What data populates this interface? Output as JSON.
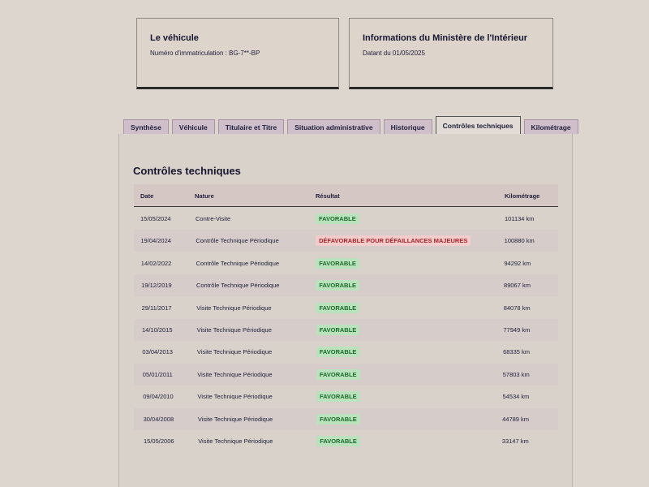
{
  "vehicle_card": {
    "title": "Le véhicule",
    "plate": "Numéro d'immatriculation : BG-7**-BP"
  },
  "ministry_card": {
    "title": "Informations du Ministère de l'Intérieur",
    "date": "Datant du 01/05/2025"
  },
  "tabs": [
    {
      "label": "Synthèse",
      "active": false
    },
    {
      "label": "Véhicule",
      "active": false
    },
    {
      "label": "Titulaire et Titre",
      "active": false
    },
    {
      "label": "Situation administrative",
      "active": false
    },
    {
      "label": "Historique",
      "active": false
    },
    {
      "label": "Contrôles techniques",
      "active": true
    },
    {
      "label": "Kilométrage",
      "active": false
    }
  ],
  "section": {
    "title": "Contrôles techniques",
    "columns": {
      "date": "Date",
      "nature": "Nature",
      "result": "Résultat",
      "mileage": "Kilométrage"
    }
  },
  "rows": [
    {
      "date": "15/05/2024",
      "nature": "Contre-Visite",
      "result": "FAVORABLE",
      "status": "ok",
      "mileage": "101134 km"
    },
    {
      "date": "19/04/2024",
      "nature": "Contrôle Technique Périodique",
      "result": "DÉFAVORABLE POUR DÉFAILLANCES MAJEURES",
      "status": "ko",
      "mileage": "100880 km"
    },
    {
      "date": "14/02/2022",
      "nature": "Contrôle Technique Périodique",
      "result": "FAVORABLE",
      "status": "ok",
      "mileage": "94292 km"
    },
    {
      "date": "19/12/2019",
      "nature": "Contrôle Technique Périodique",
      "result": "FAVORABLE",
      "status": "ok",
      "mileage": "89067 km"
    },
    {
      "date": "29/11/2017",
      "nature": "Visite Technique Périodique",
      "result": "FAVORABLE",
      "status": "ok",
      "mileage": "84078 km"
    },
    {
      "date": "14/10/2015",
      "nature": "Visite Technique Périodique",
      "result": "FAVORABLE",
      "status": "ok",
      "mileage": "77949 km"
    },
    {
      "date": "03/04/2013",
      "nature": "Visite Technique Périodique",
      "result": "FAVORABLE",
      "status": "ok",
      "mileage": "68335 km"
    },
    {
      "date": "05/01/2011",
      "nature": "Visite Technique Périodique",
      "result": "FAVORABLE",
      "status": "ok",
      "mileage": "57803 km"
    },
    {
      "date": "09/04/2010",
      "nature": "Visite Technique Périodique",
      "result": "FAVORABLE",
      "status": "ok",
      "mileage": "54534 km"
    },
    {
      "date": "30/04/2008",
      "nature": "Visite Technique Périodique",
      "result": "FAVORABLE",
      "status": "ok",
      "mileage": "44789 km"
    },
    {
      "date": "15/05/2006",
      "nature": "Visite Technique Périodique",
      "result": "FAVORABLE",
      "status": "ok",
      "mileage": "33147 km"
    }
  ],
  "colors": {
    "favorable_bg": "#b9e2bd",
    "favorable_text": "#1d6b2c",
    "defavorable_bg": "#f3cccc",
    "defavorable_text": "#a8232a",
    "tab_bg": "#cfbfcb"
  }
}
